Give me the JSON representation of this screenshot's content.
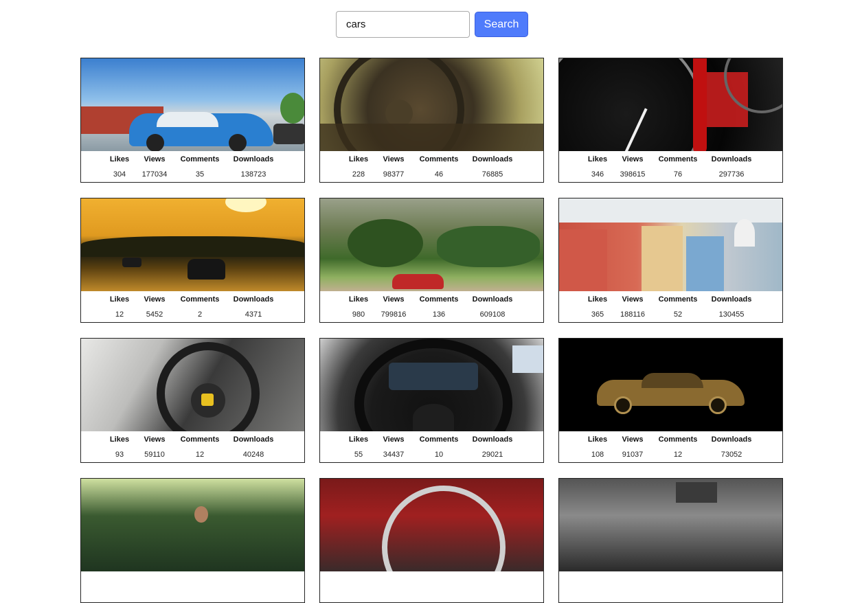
{
  "search": {
    "value": "cars",
    "button_label": "Search"
  },
  "stat_labels": {
    "likes": "Likes",
    "views": "Views",
    "comments": "Comments",
    "downloads": "Downloads"
  },
  "cards": [
    {
      "likes": "304",
      "views": "177034",
      "comments": "35",
      "downloads": "138723"
    },
    {
      "likes": "228",
      "views": "98377",
      "comments": "46",
      "downloads": "76885"
    },
    {
      "likes": "346",
      "views": "398615",
      "comments": "76",
      "downloads": "297736"
    },
    {
      "likes": "12",
      "views": "5452",
      "comments": "2",
      "downloads": "4371"
    },
    {
      "likes": "980",
      "views": "799816",
      "comments": "136",
      "downloads": "609108"
    },
    {
      "likes": "365",
      "views": "188116",
      "comments": "52",
      "downloads": "130455"
    },
    {
      "likes": "93",
      "views": "59110",
      "comments": "12",
      "downloads": "40248"
    },
    {
      "likes": "55",
      "views": "34437",
      "comments": "10",
      "downloads": "29021"
    },
    {
      "likes": "108",
      "views": "91037",
      "comments": "12",
      "downloads": "73052"
    }
  ]
}
